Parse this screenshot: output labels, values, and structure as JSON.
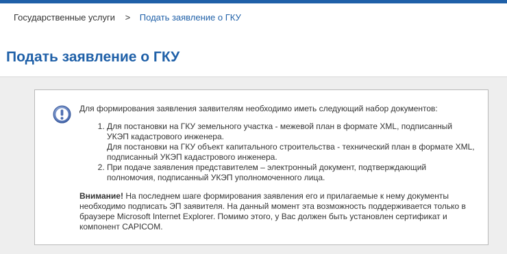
{
  "colors": {
    "accent": "#1f60a8",
    "content_bg": "#eeeeee",
    "panel_border": "#b9b9b9",
    "icon": "#5a79b8"
  },
  "breadcrumb": {
    "home": "Государственные услуги",
    "separator": ">",
    "current": "Подать заявление о ГКУ"
  },
  "page": {
    "title": "Подать заявление о ГКУ"
  },
  "notice": {
    "icon": "exclamation-info-icon",
    "intro": "Для формирования заявления заявителям необходимо иметь следующий набор документов:",
    "items": [
      {
        "line1": "Для постановки на ГКУ земельного участка - межевой план в формате XML, подписанный",
        "line2": "УКЭП кадастрового инженера.",
        "line3": "Для постановки на ГКУ объект капитального строительства - технический план в формате XML,",
        "line4": "подписанный УКЭП кадастрового инженера."
      },
      {
        "line1": "При подаче заявления представителем – электронный документ, подтверждающий",
        "line2": "полномочия, подписанный УКЭП уполномоченного лица."
      }
    ],
    "warning_label": "Внимание!",
    "warning_line1": " На последнем шаге формирования заявления его и прилагаемые к нему документы",
    "warning_line2": "необходимо подписать ЭП заявителя. На данный момент эта возможность поддерживается только в",
    "warning_line3": "браузере Microsoft Internet Explorer. Помимо этого, у Вас должен быть установлен сертификат и",
    "warning_line4": "компонент CAPICOM."
  }
}
